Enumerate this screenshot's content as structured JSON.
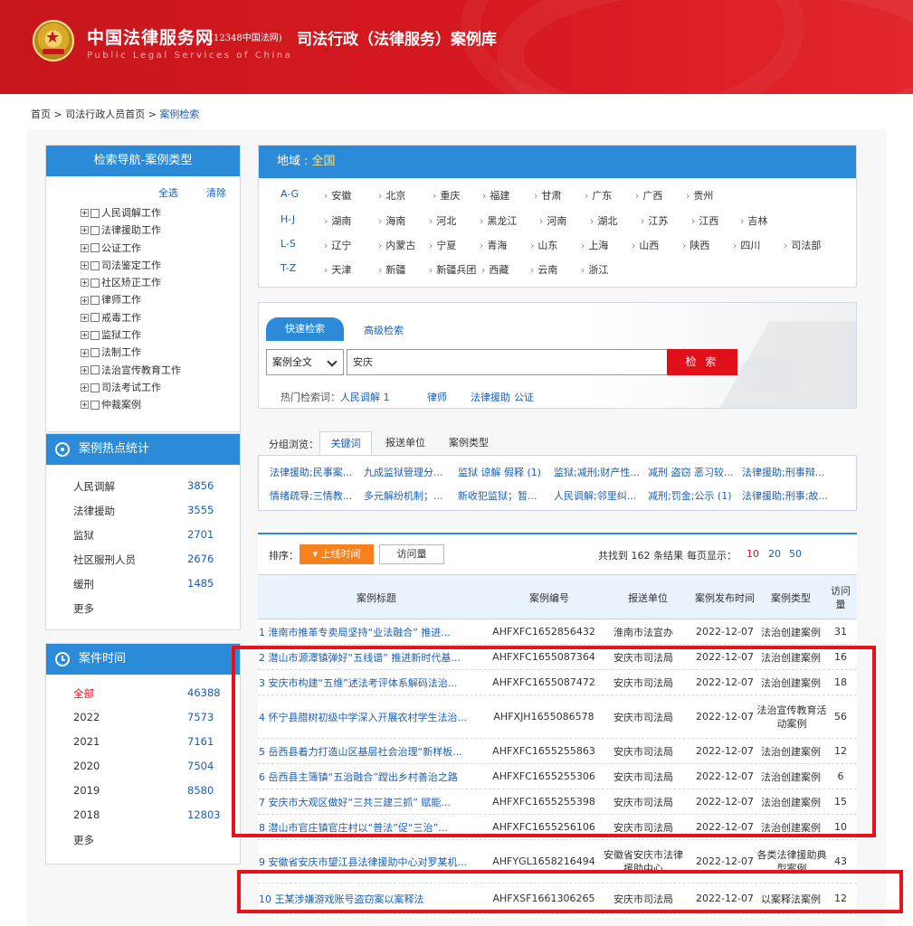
{
  "header": {
    "site_name": "中国法律服务网",
    "site_sub": "(12348中国法网)",
    "site_en": "Public Legal Services of China",
    "db_title": "司法行政（法律服务）案例库"
  },
  "breadcrumb": {
    "home": "首页",
    "sep": " > ",
    "level2": "司法行政人员首页",
    "current": "案例检索"
  },
  "nav": {
    "title": "检索导航-案例类型",
    "select_all": "全选",
    "clear": "清除",
    "items": [
      "人民调解工作",
      "法律援助工作",
      "公证工作",
      "司法鉴定工作",
      "社区矫正工作",
      "律师工作",
      "戒毒工作",
      "监狱工作",
      "法制工作",
      "法治宣传教育工作",
      "司法考试工作",
      "仲裁案例"
    ]
  },
  "stats": {
    "title": "案例热点统计",
    "rows": [
      {
        "label": "人民调解",
        "count": "3856"
      },
      {
        "label": "法律援助",
        "count": "3555"
      },
      {
        "label": "监狱",
        "count": "2701"
      },
      {
        "label": "社区服刑人员",
        "count": "2676"
      },
      {
        "label": "缓刑",
        "count": "1485"
      }
    ],
    "more": "更多"
  },
  "time": {
    "title": "案件时间",
    "rows": [
      {
        "label": "全部",
        "count": "46388"
      },
      {
        "label": "2022",
        "count": "7573"
      },
      {
        "label": "2021",
        "count": "7161"
      },
      {
        "label": "2020",
        "count": "7504"
      },
      {
        "label": "2019",
        "count": "8580"
      },
      {
        "label": "2018",
        "count": "12803"
      }
    ],
    "more": "更多"
  },
  "region": {
    "label": "地域 :",
    "all": "全国",
    "rows": [
      {
        "letter": "A-G",
        "provinces": [
          "安徽",
          "北京",
          "重庆",
          "福建",
          "甘肃",
          "广东",
          "广西",
          "贵州"
        ]
      },
      {
        "letter": "H-J",
        "provinces": [
          "湖南",
          "海南",
          "河北",
          "黑龙江",
          "河南",
          "湖北",
          "江苏",
          "江西",
          "吉林"
        ]
      },
      {
        "letter": "L-S",
        "provinces": [
          "辽宁",
          "内蒙古",
          "宁夏",
          "青海",
          "山东",
          "上海",
          "山西",
          "陕西",
          "四川",
          "司法部"
        ]
      },
      {
        "letter": "T-Z",
        "provinces": [
          "天津",
          "新疆",
          "新疆兵团",
          "西藏",
          "云南",
          "浙江"
        ]
      }
    ]
  },
  "search": {
    "tab_quick": "快速检索",
    "tab_advanced": "高级检索",
    "scope": "案例全文",
    "query": "安庆",
    "button": "检 索",
    "hot_label": "热门检索词：",
    "hot_terms": [
      "人民调解 1",
      "律师",
      "法律援助",
      "公证"
    ]
  },
  "group": {
    "label": "分组浏览：",
    "tabs": [
      "关键词",
      "报送单位",
      "案例类型"
    ],
    "keywords": [
      "法律援助;民事案...",
      "九成监狱管理分...",
      "监狱 谅解 假释 (1)",
      "监狱;减刑;财产性...",
      "减刑 盗窃 恶习较...",
      "法律援助;刑事辩...",
      "情绪疏导;三情教...",
      "多元解纷机制；...",
      "新收犯监狱；暂...",
      "人民调解;邻里纠...",
      "减刑;罚金;公示 (1)",
      "法律援助;刑事;故..."
    ]
  },
  "results": {
    "sort_label": "排序：",
    "sort_active": "▾ 上线时间",
    "sort_other": "访问量",
    "found_text": "共找到 162 条结果",
    "per_page_label": "每页显示：",
    "per_page": [
      "10",
      "20",
      "50"
    ],
    "headers": [
      "案例标题",
      "案例编号",
      "报送单位",
      "案例发布时间",
      "案例类型",
      "访问量"
    ],
    "rows": [
      {
        "title": "1 淮南市推革专卖局坚持“业法融合” 推进...",
        "code": "AHFXFC1652856432",
        "unit": "淮南市法宣办",
        "date": "2022-12-07",
        "type": "法治创建案例",
        "views": "31"
      },
      {
        "title": "2 潜山市源潭镇弹好“五线谱” 推进新时代基...",
        "code": "AHFXFC1655087364",
        "unit": "安庆市司法局",
        "date": "2022-12-07",
        "type": "法治创建案例",
        "views": "16"
      },
      {
        "title": "3 安庆市构建“五维”述法考评体系解码法治...",
        "code": "AHFXFC1655087472",
        "unit": "安庆市司法局",
        "date": "2022-12-07",
        "type": "法治创建案例",
        "views": "18"
      },
      {
        "title": "4 怀宁县腊树初级中学深入开展农村学生法治...",
        "code": "AHFXJH1655086578",
        "unit": "安庆市司法局",
        "date": "2022-12-07",
        "type": "法治宣传教育活动案例",
        "views": "56"
      },
      {
        "title": "5 岳西县着力打造山区基层社会治理“新样板...",
        "code": "AHFXFC1655255863",
        "unit": "安庆市司法局",
        "date": "2022-12-07",
        "type": "法治创建案例",
        "views": "12"
      },
      {
        "title": "6 岳西县主簿镇“五治融合”蹚出乡村善治之路",
        "code": "AHFXFC1655255306",
        "unit": "安庆市司法局",
        "date": "2022-12-07",
        "type": "法治创建案例",
        "views": "6"
      },
      {
        "title": "7 安庆市大观区做好“三共三建三抓” 赋能...",
        "code": "AHFXFC1655255398",
        "unit": "安庆市司法局",
        "date": "2022-12-07",
        "type": "法治创建案例",
        "views": "15"
      },
      {
        "title": "8 潜山市官庄镇官庄村以“普法”促“三治”...",
        "code": "AHFXFC1655256106",
        "unit": "安庆市司法局",
        "date": "2022-12-07",
        "type": "法治创建案例",
        "views": "10"
      },
      {
        "title": "9 安徽省安庆市望江县法律援助中心对罗某机...",
        "code": "AHFYGL1658216494",
        "unit": "安徽省安庆市法律援助中心",
        "date": "2022-12-07",
        "type": "各类法律援助典型案例",
        "views": "43"
      },
      {
        "title": "10 王某涉嫌游戏账号盗窃案以案释法",
        "code": "AHFXSF1661306265",
        "unit": "安庆市司法局",
        "date": "2022-12-07",
        "type": "以案释法案例",
        "views": "12"
      }
    ]
  },
  "colors": {
    "header_red": "#d71920",
    "nav_blue": "#2b8bd9",
    "link_blue": "#1a5fb4",
    "search_red": "#e10f19",
    "sort_orange": "#f7811d",
    "highlight_red": "#e8121a"
  }
}
